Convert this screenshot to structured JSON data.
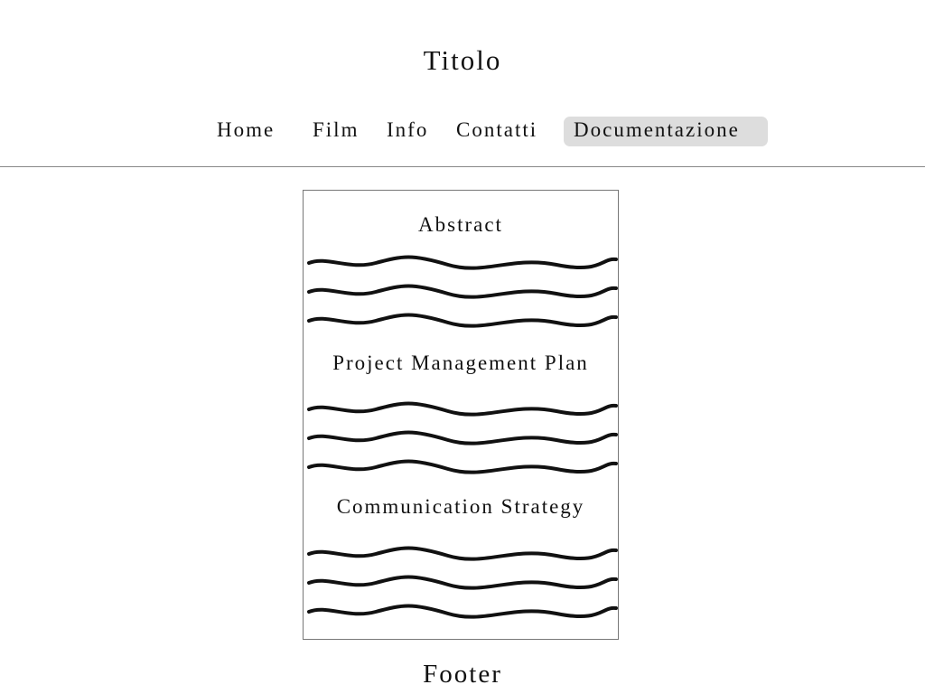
{
  "header": {
    "title": "Titolo"
  },
  "nav": {
    "items": [
      {
        "label": "Home",
        "active": false
      },
      {
        "label": "Film",
        "active": false
      },
      {
        "label": "Info",
        "active": false
      },
      {
        "label": "Contatti",
        "active": false
      },
      {
        "label": "Documentazione",
        "active": true
      }
    ]
  },
  "documentation": {
    "sections": [
      {
        "heading": "Abstract",
        "placeholder_lines": 3
      },
      {
        "heading": "Project Management Plan",
        "placeholder_lines": 3
      },
      {
        "heading": "Communication Strategy",
        "placeholder_lines": 3
      }
    ]
  },
  "footer": {
    "text": "Footer"
  },
  "colors": {
    "active_tab_background": "#dddddd",
    "rule": "#888888",
    "panel_border": "#777777",
    "text": "#111111"
  }
}
